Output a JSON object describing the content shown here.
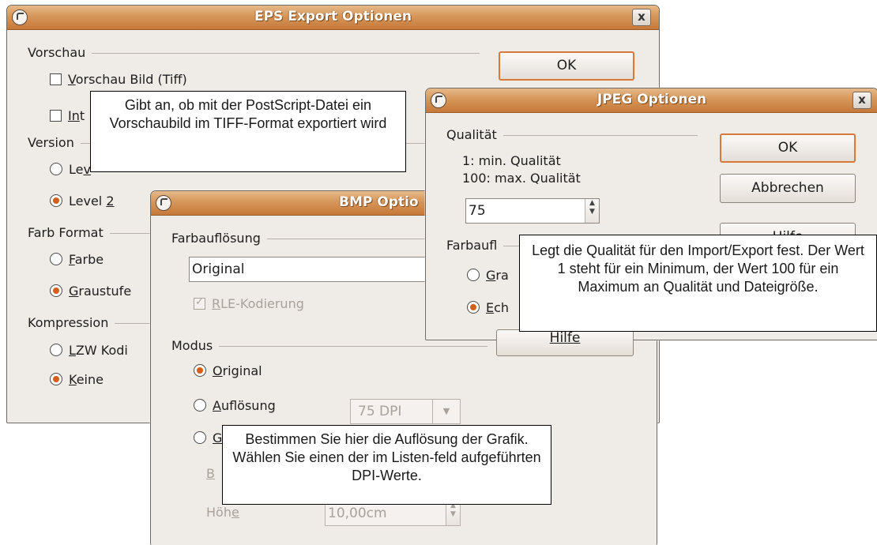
{
  "eps": {
    "title": "EPS Export Optionen",
    "close_label": "x",
    "ok_label": "OK",
    "preview_header": "Vorschau",
    "preview_tiff_m": "V",
    "preview_tiff_rest": "orschau Bild (Tiff)",
    "interchange_m": "In",
    "interchange_rest": "t",
    "version_header": "Version",
    "level1_m": "Le",
    "level1_rest": "v",
    "level2_label": "Level ",
    "level2_m": "2",
    "color_header": "Farb Format",
    "color_m": "F",
    "color_rest": "arbe",
    "gray_m": "G",
    "gray_rest": "raustufe",
    "compression_header": "Kompression",
    "lzw_m": "L",
    "lzw_rest": "ZW Kodi",
    "none_m": "K",
    "none_rest": "eine",
    "tooltip": "Gibt an, ob mit der PostScript-Datei ein Vorschaubild im TIFF-Format exportiert wird"
  },
  "bmp": {
    "title": "BMP Optio",
    "color_res_header": "Farbauflösung",
    "color_res_value": "Original",
    "rle_m": "R",
    "rle_rest": "LE-Kodierung",
    "mode_header": "Modus",
    "mode_original_m": "O",
    "mode_original_rest": "riginal",
    "mode_resolution_m": "A",
    "mode_resolution_rest": "uflösung",
    "resolution_value": "75 DPI",
    "mode_size_m": "G",
    "width_m": "B",
    "height_label": "Höh",
    "height_m": "e",
    "height_value": "10,00cm",
    "tooltip": "Bestimmen Sie hier die Auflösung der Grafik. Wählen Sie einen der im Listen-feld aufgeführten DPI-Werte."
  },
  "jpeg": {
    "title": "JPEG Optionen",
    "close_label": "x",
    "quality_header": "Qualität",
    "quality_min": "1: min. Qualität",
    "quality_max": "100: max. Qualität",
    "quality_value": "75",
    "ok_label": "OK",
    "cancel_label": "Abbrechen",
    "help_label": "Hilfe",
    "color_res_header": "Farbaufl",
    "gray_m": "G",
    "gray_rest": "ra",
    "real_m": "E",
    "real_rest": "ch",
    "tooltip": "Legt die Qualität für den Import/Export fest. Der Wert 1 steht für ein Minimum, der Wert 100 für ein Maximum an Qualität und Dateigröße."
  },
  "colors": {
    "title_bar": "#d69659",
    "dialog_bg": "#efebe7",
    "accent": "#d65d1a"
  }
}
